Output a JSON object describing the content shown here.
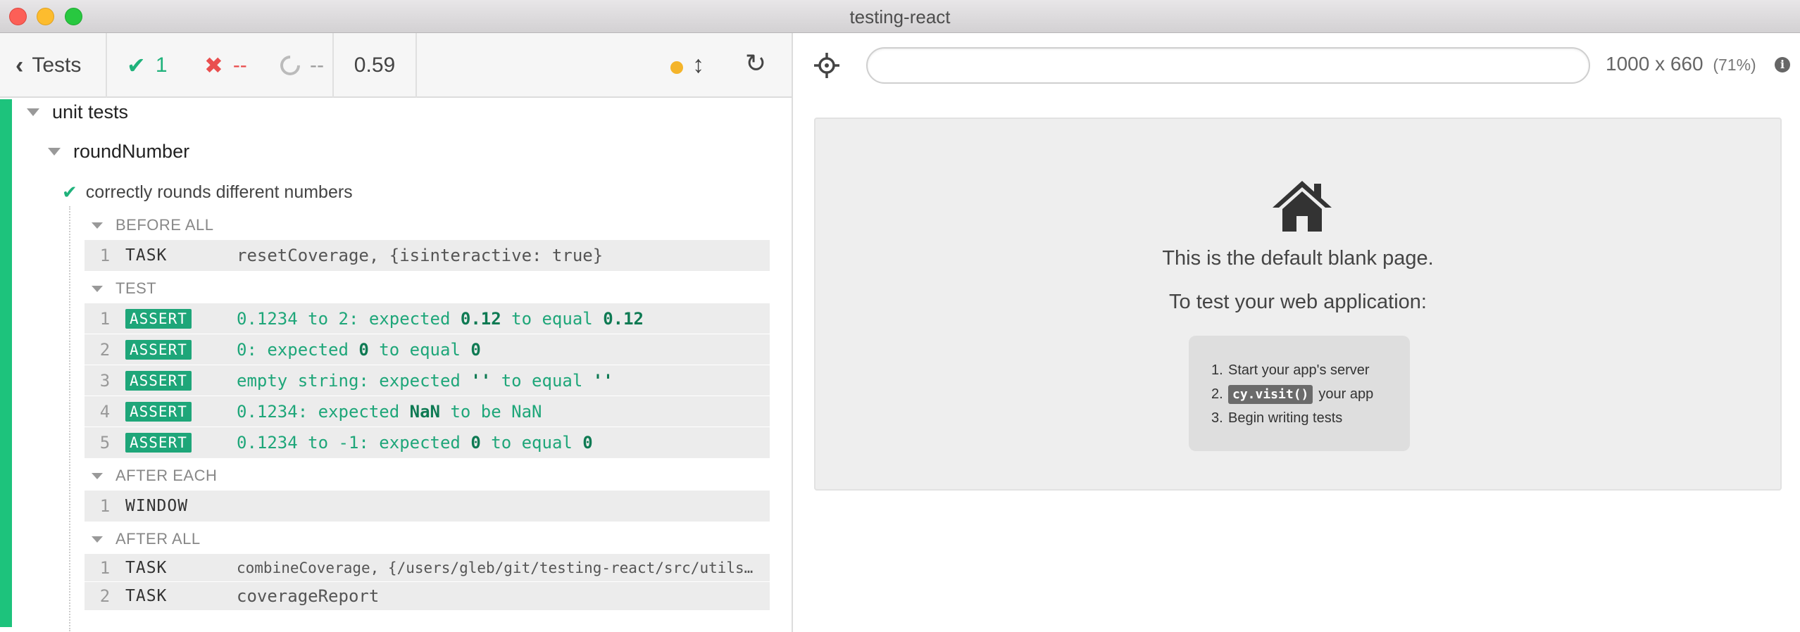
{
  "window": {
    "title": "testing-react"
  },
  "reporter": {
    "tests_label": "Tests",
    "stats": {
      "passed": "1",
      "failed": "--",
      "pending": "--"
    },
    "duration": "0.59",
    "status_dot_color": "#f4b42a"
  },
  "tree": {
    "suite": "unit tests",
    "sub_suite": "roundNumber",
    "test": "correctly rounds different numbers",
    "hooks": {
      "before_all": {
        "label": "BEFORE ALL",
        "commands": [
          {
            "num": "1",
            "name": "TASK",
            "message": "resetCoverage, {isinteractive: true}"
          }
        ]
      },
      "test": {
        "label": "TEST",
        "commands": [
          {
            "num": "1",
            "name": "ASSERT",
            "pre": "0.1234 to 2: expected ",
            "v1": "0.12",
            "mid": " to equal ",
            "v2": "0.12"
          },
          {
            "num": "2",
            "name": "ASSERT",
            "pre": "0: expected ",
            "v1": "0",
            "mid": " to equal ",
            "v2": "0"
          },
          {
            "num": "3",
            "name": "ASSERT",
            "pre": "empty string: expected ",
            "v1": "''",
            "mid": " to equal ",
            "v2": "''"
          },
          {
            "num": "4",
            "name": "ASSERT",
            "pre": "0.1234: expected ",
            "v1": "NaN",
            "mid": " to be NaN",
            "v2": ""
          },
          {
            "num": "5",
            "name": "ASSERT",
            "pre": "0.1234 to -1: expected ",
            "v1": "0",
            "mid": " to equal ",
            "v2": "0"
          }
        ]
      },
      "after_each": {
        "label": "AFTER EACH",
        "commands": [
          {
            "num": "1",
            "name": "WINDOW",
            "message": ""
          }
        ]
      },
      "after_all": {
        "label": "AFTER ALL",
        "commands": [
          {
            "num": "1",
            "name": "TASK",
            "message": "combineCoverage, {/users/gleb/git/testing-react/src/utils/m…"
          },
          {
            "num": "2",
            "name": "TASK",
            "message": "coverageReport"
          }
        ]
      }
    }
  },
  "aut": {
    "url": "",
    "viewport": "1000 x 660",
    "scale": "(71%)",
    "blank": {
      "line1": "This is the default blank page.",
      "line2": "To test your web application:",
      "steps": [
        {
          "n": "1.",
          "text": "Start your app's server",
          "code": ""
        },
        {
          "n": "2.",
          "text": "your app",
          "code": "cy.visit()"
        },
        {
          "n": "3.",
          "text": "Begin writing tests",
          "code": ""
        }
      ]
    }
  },
  "icons": [
    "chevron-left-icon",
    "check-icon",
    "x-icon",
    "spinner-icon",
    "updown-arrow-icon",
    "reload-icon",
    "crosshair-icon",
    "info-icon",
    "home-icon",
    "caret-down-icon"
  ],
  "colors": {
    "pass": "#1dc37c",
    "fail": "#e94f4f",
    "assert_badge": "#1ea679"
  }
}
